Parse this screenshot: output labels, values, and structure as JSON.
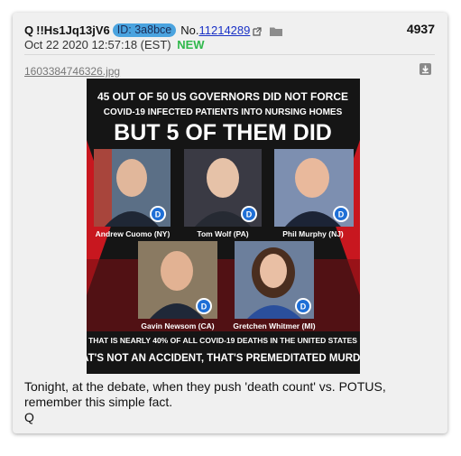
{
  "header": {
    "author": "Q",
    "tripcode": "!!Hs1Jq13jV6",
    "id_badge": "ID: 3a8bce",
    "no_label": "No.",
    "post_number": "11214289",
    "post_count": "4937"
  },
  "meta": {
    "date": "Oct 22 2020 12:57:18 (EST)",
    "new_badge": "NEW"
  },
  "attachment": {
    "file_name": "1603384746326.jpg",
    "headline_line1": "45 OUT OF 50 US GOVERNORS DID NOT FORCE",
    "headline_line2": "COVID-19 INFECTED PATIENTS INTO NURSING HOMES",
    "headline_big": "BUT 5 OF THEM DID",
    "captions": [
      "Andrew Cuomo (NY)",
      "Tom Wolf (PA)",
      "Phil Murphy (NJ)",
      "Gavin Newsom (CA)",
      "Gretchen Whitmer (MI)"
    ],
    "party_letter": "D",
    "footer_line1": "THAT IS NEARLY 40% OF ALL COVID-19 DEATHS IN THE UNITED STATES",
    "footer_line2": "THAT'S NOT AN ACCIDENT, THAT'S PREMEDITATED MURDER!"
  },
  "body": {
    "line1": "Tonight, at the debate, when they push 'death count' vs. POTUS,",
    "line2": "remember this simple fact.",
    "line3": "Q"
  },
  "colors": {
    "post_bg": "#f0f0f0",
    "id_badge": "#4aa3df",
    "new_badge": "#2fb84b",
    "link": "#1a32c6",
    "poster_bg": "#151515",
    "poster_red": "#c8171f",
    "dem_blue": "#1f6fd6"
  }
}
